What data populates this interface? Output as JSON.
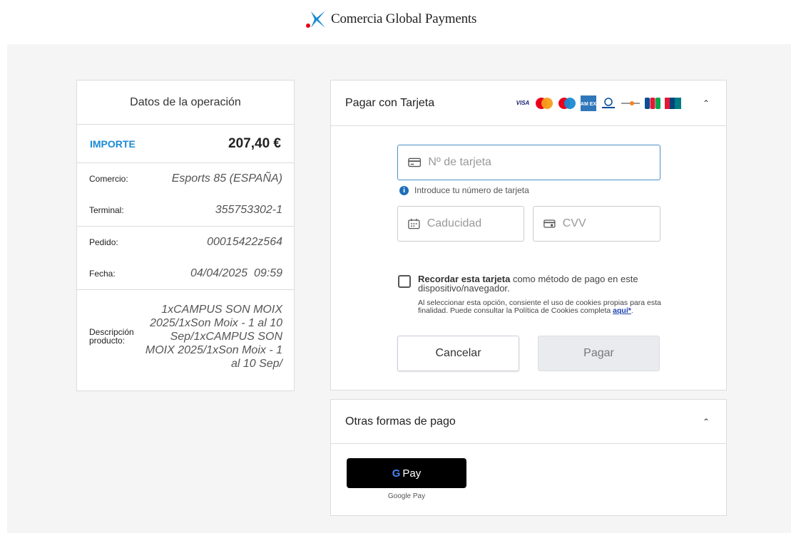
{
  "brand": {
    "name": "Comercia Global Payments"
  },
  "summary": {
    "title": "Datos de la operación",
    "amount_label": "IMPORTE",
    "amount_value": "207,40 €",
    "merchant_label": "Comercio:",
    "merchant_value": "Esports 85 (ESPAÑA)",
    "terminal_label": "Terminal:",
    "terminal_value": "355753302-1",
    "order_label": "Pedido:",
    "order_value": "00015422z564",
    "date_label": "Fecha:",
    "date_value": "04/04/2025  09:59",
    "description_label": "Descripción producto:",
    "description_value": "1xCAMPUS SON MOIX 2025/1xSon Moix - 1 al 10 Sep/1xCAMPUS SON MOIX 2025/1xSon Moix - 1 al 10 Sep/"
  },
  "card_payment": {
    "title": "Pagar con Tarjeta",
    "card_brands": [
      "VISA",
      "Mastercard",
      "Maestro",
      "American Express",
      "Diners Club",
      "Discover",
      "JCB",
      "UnionPay"
    ],
    "card_number_placeholder": "Nº de tarjeta",
    "card_number_hint": "Introduce tu número de tarjeta",
    "expiry_placeholder": "Caducidad",
    "cvv_placeholder": "CVV",
    "remember_bold": "Recordar esta tarjeta",
    "remember_text": " como método de pago en este dispositivo/navegador.",
    "consent_text": "Al seleccionar esta opción, consiente el uso de cookies propias para esta finalidad. Puede consultar la Política de Cookies completa ",
    "consent_link": "aquí*",
    "consent_end": ".",
    "cancel_label": "Cancelar",
    "pay_label": "Pagar"
  },
  "other_methods": {
    "title": "Otras formas de pago",
    "gpay_g": "G",
    "gpay_text": "Pay",
    "gpay_label": "Google Pay"
  },
  "colors": {
    "accent_blue": "#1d8ad4",
    "background": "#f5f5f5",
    "logo_blue": "#1a8ad2",
    "logo_red": "#e2001a",
    "focus_border": "#4a90c6"
  },
  "icons": {
    "logo": "star-logo-icon",
    "card_number": "credit-card-icon",
    "expiry": "calendar-icon",
    "cvv": "card-back-icon",
    "info": "info-icon",
    "collapse": "chevron-up-icon"
  }
}
